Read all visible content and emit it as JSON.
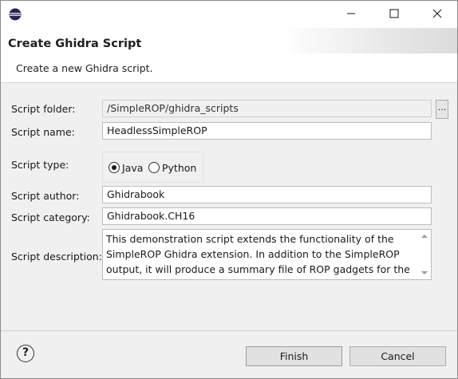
{
  "titlebar": {
    "icons": {
      "app": "eclipse-icon",
      "minimize": "minimize-icon",
      "maximize": "maximize-icon",
      "close": "close-icon"
    }
  },
  "header": {
    "title": "Create Ghidra Script",
    "description": "Create a new Ghidra script."
  },
  "form": {
    "folder": {
      "label": "Script folder:",
      "value": "/SimpleROP/ghidra_scripts",
      "browse_label": "..."
    },
    "name": {
      "label": "Script name:",
      "value": "HeadlessSimpleROP"
    },
    "type": {
      "label": "Script type:",
      "options": [
        "Java",
        "Python"
      ],
      "selected": "Java"
    },
    "author": {
      "label": "Script author:",
      "value": "Ghidrabook"
    },
    "category": {
      "label": "Script category:",
      "value": "Ghidrabook.CH16"
    },
    "description": {
      "label": "Script description:",
      "value": "This demonstration script extends the functionality of the SimpleROP Ghidra extension.  In addition to the SimpleROP output, it will produce a summary file of ROP gadgets for the"
    }
  },
  "footer": {
    "help_icon": "help-icon",
    "help_glyph": "?",
    "finish_label": "Finish",
    "cancel_label": "Cancel"
  },
  "colors": {
    "window_bg": "#f0f0f0",
    "banner_bg": "#ffffff",
    "field_border": "#bcbcbc",
    "button_bg": "#e1e1e1"
  }
}
